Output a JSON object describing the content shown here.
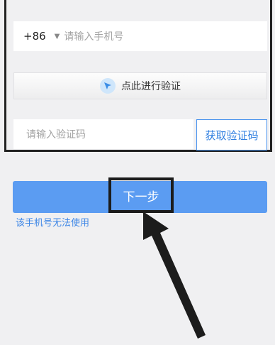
{
  "phone": {
    "country_code": "+86",
    "caret": "▼",
    "placeholder": "请输入手机号"
  },
  "verification": {
    "label": "点此进行验证",
    "icon": "cursor-verify-icon"
  },
  "code": {
    "placeholder": "请输入验证码",
    "get_code_label": "获取验证码"
  },
  "next_button": {
    "label": "下一步"
  },
  "unavailable_link": "该手机号无法使用",
  "colors": {
    "accent": "#5b9cf2",
    "link": "#3d86e6",
    "annotation": "#1c1c1c"
  }
}
